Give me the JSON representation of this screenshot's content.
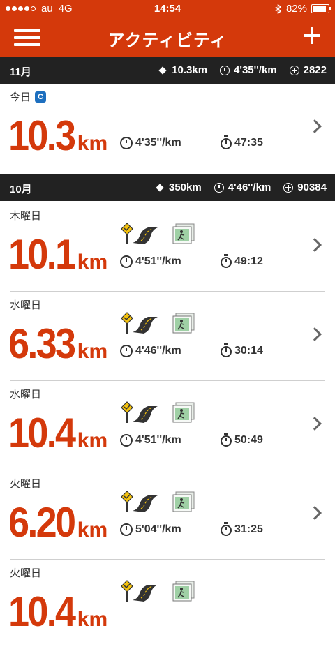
{
  "status": {
    "carrier": "au",
    "network": "4G",
    "time": "14:54",
    "battery": "82%"
  },
  "nav": {
    "title": "アクティビティ"
  },
  "sections": [
    {
      "month": "11月",
      "distance": "10.3km",
      "pace": "4'35''/km",
      "fuel": "2822"
    },
    {
      "month": "10月",
      "distance": "350km",
      "pace": "4'46''/km",
      "fuel": "90384"
    }
  ],
  "runs": [
    {
      "day": "今日",
      "value": "10.3",
      "unit": "km",
      "pace": "4'35''/km",
      "duration": "47:35"
    },
    {
      "day": "木曜日",
      "value": "10.1",
      "unit": "km",
      "pace": "4'51''/km",
      "duration": "49:12"
    },
    {
      "day": "水曜日",
      "value": "6.33",
      "unit": "km",
      "pace": "4'46''/km",
      "duration": "30:14"
    },
    {
      "day": "水曜日",
      "value": "10.4",
      "unit": "km",
      "pace": "4'51''/km",
      "duration": "50:49"
    },
    {
      "day": "火曜日",
      "value": "6.20",
      "unit": "km",
      "pace": "5'04''/km",
      "duration": "31:25"
    },
    {
      "day": "火曜日",
      "value": "10.4",
      "unit": "km"
    }
  ],
  "colors": {
    "brand": "#d4390b",
    "header": "#222222"
  }
}
